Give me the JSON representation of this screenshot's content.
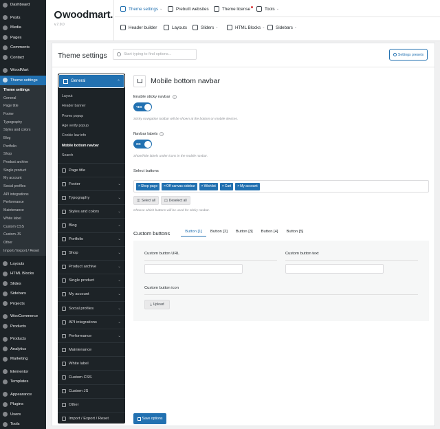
{
  "wp_menu": [
    {
      "label": "Dashboard",
      "icon": "dashboard-icon"
    },
    {
      "label": "Posts",
      "icon": "pin-icon",
      "sep": true
    },
    {
      "label": "Media",
      "icon": "media-icon"
    },
    {
      "label": "Pages",
      "icon": "page-icon"
    },
    {
      "label": "Comments",
      "icon": "comment-icon"
    },
    {
      "label": "Contact",
      "icon": "mail-icon"
    },
    {
      "label": "WoodMart",
      "icon": "woodmart-icon",
      "sep": true
    },
    {
      "label": "Theme settings",
      "icon": "settings-icon",
      "active": true
    }
  ],
  "wp_submenu": [
    "Theme settings",
    "General",
    "Page title",
    "Footer",
    "Typography",
    "Styles and colors",
    "Blog",
    "Portfolio",
    "Shop",
    "Product archive",
    "Single product",
    "My account",
    "Social profiles",
    "API integrations",
    "Performance",
    "Maintenance",
    "White label",
    "Custom CSS",
    "Custom JS",
    "Other",
    "Import / Export / Reset"
  ],
  "wp_menu2": [
    {
      "label": "Layouts",
      "icon": "layout-icon",
      "sep": true
    },
    {
      "label": "HTML Blocks",
      "icon": "html-icon"
    },
    {
      "label": "Slides",
      "icon": "slides-icon"
    },
    {
      "label": "Sidebars",
      "icon": "sidebar-icon"
    },
    {
      "label": "Projects",
      "icon": "projects-icon"
    },
    {
      "label": "WooCommerce",
      "icon": "woo-icon",
      "sep": true
    },
    {
      "label": "Products",
      "icon": "products-icon"
    },
    {
      "label": "Products",
      "icon": "products-icon",
      "sep": true
    },
    {
      "label": "Analytics",
      "icon": "analytics-icon"
    },
    {
      "label": "Marketing",
      "icon": "marketing-icon"
    },
    {
      "label": "Elementor",
      "icon": "elementor-icon",
      "sep": true
    },
    {
      "label": "Templates",
      "icon": "templates-icon"
    },
    {
      "label": "Appearance",
      "icon": "appearance-icon",
      "sep": true
    },
    {
      "label": "Plugins",
      "icon": "plugins-icon"
    },
    {
      "label": "Users",
      "icon": "users-icon"
    },
    {
      "label": "Tools",
      "icon": "tools-icon"
    }
  ],
  "header": {
    "logo": "woodmart.",
    "version": "v.7.0.0",
    "nav_top": [
      {
        "label": "Theme settings",
        "caret": true,
        "on": true
      },
      {
        "label": "Prebuilt websites"
      },
      {
        "label": "Theme license",
        "dot": true
      },
      {
        "label": "Tools",
        "caret": true
      }
    ],
    "nav_bottom": [
      {
        "label": "Header builder"
      },
      {
        "label": "Layouts"
      },
      {
        "label": "Sliders",
        "caret": true
      },
      {
        "label": "HTML Blocks",
        "caret": true
      },
      {
        "label": "Sidebars",
        "caret": true
      }
    ]
  },
  "panel": {
    "title": "Theme settings",
    "search_placeholder": "Start typing to find options...",
    "presets_label": "Settings presets"
  },
  "options_nav": {
    "general": "General",
    "general_sub": [
      "Layout",
      "Header banner",
      "Promo popup",
      "Age verify popup",
      "Cookie law info",
      "Mobile bottom navbar",
      "Search"
    ],
    "current_sub": "Mobile bottom navbar",
    "items": [
      {
        "label": "Page title",
        "caret": false
      },
      {
        "label": "Footer",
        "caret": true
      },
      {
        "label": "Typography",
        "caret": true
      },
      {
        "label": "Styles and colors",
        "caret": true
      },
      {
        "label": "Blog",
        "caret": true
      },
      {
        "label": "Portfolio",
        "caret": true
      },
      {
        "label": "Shop",
        "caret": true
      },
      {
        "label": "Product archive",
        "caret": true
      },
      {
        "label": "Single product",
        "caret": true
      },
      {
        "label": "My account",
        "caret": true
      },
      {
        "label": "Social profiles",
        "caret": true
      },
      {
        "label": "API integrations",
        "caret": true
      },
      {
        "label": "Performance",
        "caret": true
      },
      {
        "label": "Maintenance",
        "caret": false
      },
      {
        "label": "White label",
        "caret": false
      },
      {
        "label": "Custom CSS",
        "caret": false
      },
      {
        "label": "Custom JS",
        "caret": false
      },
      {
        "label": "Other",
        "caret": false
      },
      {
        "label": "Import / Export / Reset",
        "caret": false
      }
    ]
  },
  "section": {
    "title": "Mobile bottom navbar",
    "sticky_label": "Enable sticky navbar",
    "sticky_toggle": "YES",
    "sticky_desc": "Sticky navigation toolbar will be shown at the bottom on mobile devices.",
    "labels_label": "Navbar labels",
    "labels_toggle": "ON",
    "labels_desc": "Show/hide labels under icons in the mobile navbar.",
    "select_label": "Select buttons",
    "chips": [
      "Shop page",
      "Off canvas sidebar",
      "Wishlist",
      "Cart",
      "My account"
    ],
    "select_all": "Select all",
    "deselect_all": "Deselect all",
    "select_desc": "Choose which buttons will be used for sticky navbar.",
    "custom_title": "Custom buttons",
    "tabs": [
      "Button [1]",
      "Button [2]",
      "Button [3]",
      "Button [4]",
      "Button [5]"
    ],
    "url_label": "Custom button URL",
    "text_label": "Custom button text",
    "icon_label": "Custom button icon",
    "upload_label": "Upload",
    "save_label": "Save options"
  }
}
